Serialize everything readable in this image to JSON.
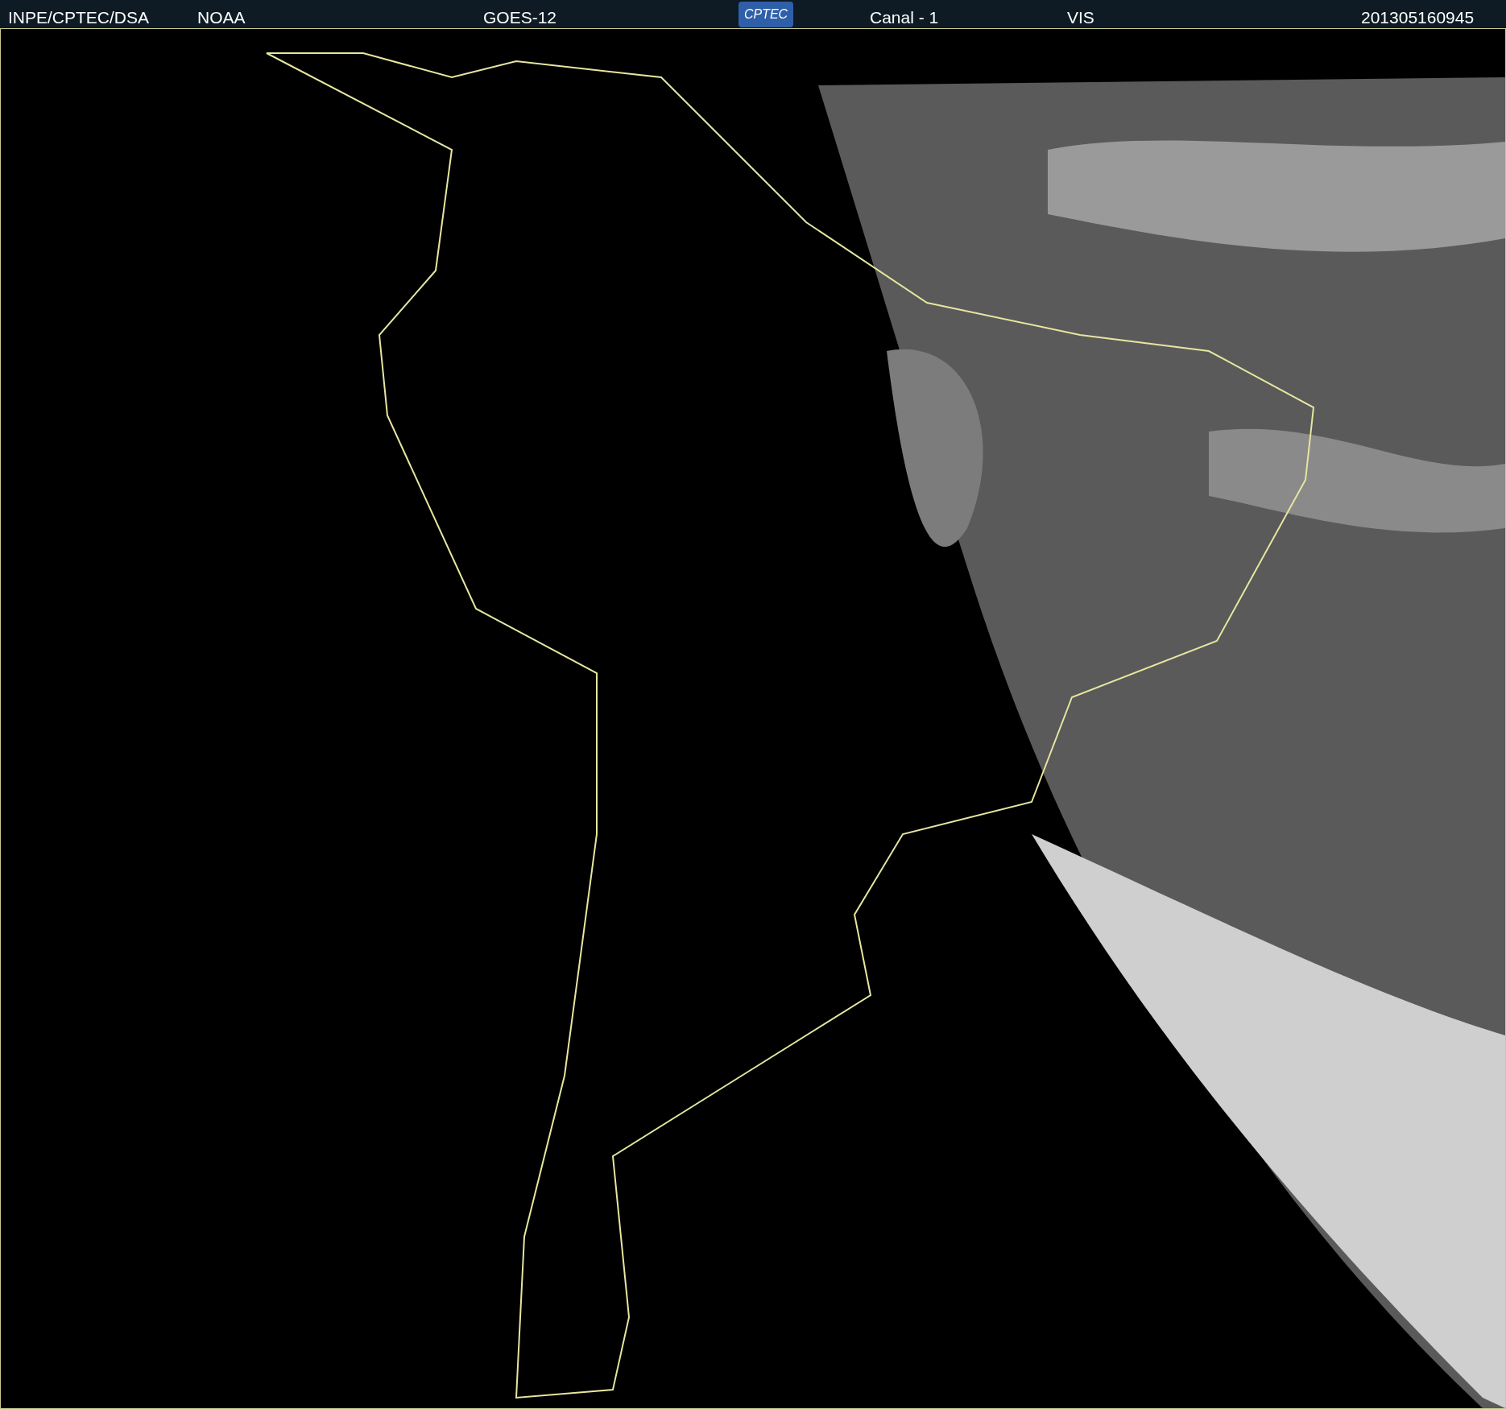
{
  "header": [
    {
      "kind": "text",
      "text": "INPE/CPTEC/DSA"
    },
    {
      "kind": "text",
      "text": "NOAA"
    },
    {
      "kind": "text",
      "text": "GOES-12"
    },
    {
      "kind": "logo",
      "text": "CPTEC"
    },
    {
      "kind": "text",
      "text": "Canal - 1"
    },
    {
      "kind": "text",
      "text": "VIS"
    },
    {
      "kind": "text",
      "text": "201305160945"
    }
  ]
}
